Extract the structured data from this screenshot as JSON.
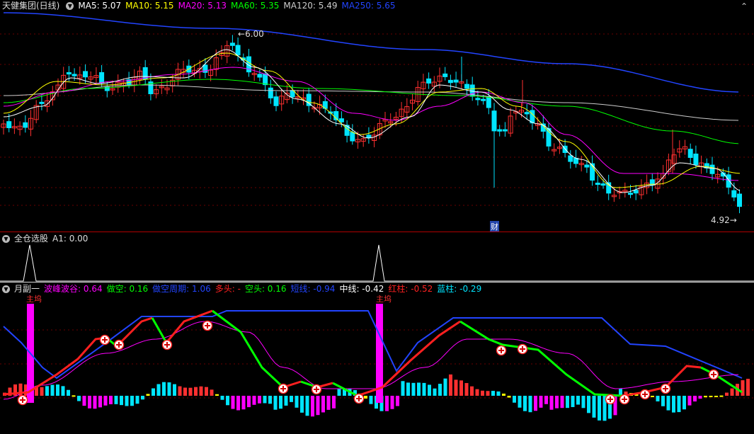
{
  "main_panel": {
    "title": "天健集团(日线)",
    "ma_indicators": [
      {
        "label": "MA5: 5.07",
        "color": "#ffffff"
      },
      {
        "label": "MA10: 5.15",
        "color": "#ffff00"
      },
      {
        "label": "MA20: 5.13",
        "color": "#ff00ff"
      },
      {
        "label": "MA60: 5.35",
        "color": "#00ff00"
      },
      {
        "label": "MA120: 5.49",
        "color": "#cccccc"
      },
      {
        "label": "MA250: 5.65",
        "color": "#2244ff"
      }
    ],
    "high_label": "6.00",
    "low_label": "4.92",
    "finance_marker": "财"
  },
  "sub1": {
    "title": "全仓选股",
    "value_label": "A1: 0.00"
  },
  "sub2": {
    "title": "月副一",
    "indicators": [
      {
        "label": "波峰波谷: 0.64",
        "color": "#ff00ff"
      },
      {
        "label": "做空: 0.16",
        "color": "#00ff00"
      },
      {
        "label": "做空周期: 1.06",
        "color": "#2244ff"
      },
      {
        "label": "多头: -",
        "color": "#ff2020"
      },
      {
        "label": "空头: 0.16",
        "color": "#00ff00"
      },
      {
        "label": "短线: -0.94",
        "color": "#2244ff"
      },
      {
        "label": "中线: -0.42",
        "color": "#ffffff"
      },
      {
        "label": "红柱: -0.52",
        "color": "#ff2020"
      },
      {
        "label": "蓝柱: -0.29",
        "color": "#00e5ff"
      }
    ],
    "marker_text": "主坞"
  },
  "colors": {
    "background": "#000000",
    "up_candle": "#ff3030",
    "down_candle": "#00e5ff",
    "separator": "#b00000",
    "grid": "#6a0000"
  }
}
